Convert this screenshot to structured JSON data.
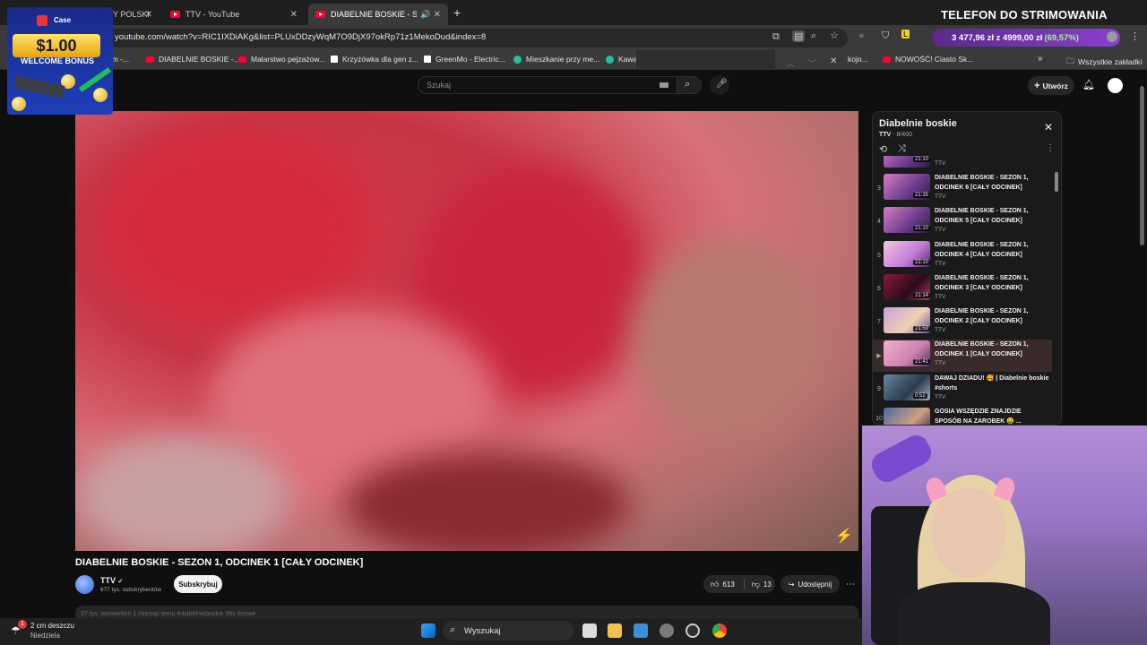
{
  "tabs": [
    {
      "label": "Y POLSKI",
      "active": false
    },
    {
      "label": "TTV - YouTube",
      "active": false
    },
    {
      "label": "DIABELNIE BOSKIE - SEZON",
      "active": true
    }
  ],
  "address": {
    "url": "youtube.com/watch?v=RIC1IXDiAKg&list=PLUxDDzyWqM7O9DjX97okRp71z1MekoDud&index=8"
  },
  "price_extension": {
    "text": "3 477,96 zł z 4999,00 zł",
    "percent": "(69,57%)"
  },
  "bookmarks": [
    {
      "label": "um -...",
      "icon": "youtube-icon"
    },
    {
      "label": "DIABELNIE BOSKIE -...",
      "icon": "youtube-icon"
    },
    {
      "label": "Malarstwo pejzażow...",
      "icon": "youtube-icon"
    },
    {
      "label": "Krzyżówka dla gen z...",
      "icon": "page-icon"
    },
    {
      "label": "GreenMo - Electric...",
      "icon": "page-icon"
    },
    {
      "label": "Mieszkanie przy me...",
      "icon": "chatgpt-icon"
    },
    {
      "label": "Kawal",
      "icon": "chatgpt-icon"
    },
    {
      "label": "kojo...",
      "icon": "page-icon"
    },
    {
      "label": "NOWOŚĆ! Ciasto Sk...",
      "icon": "youtube-icon"
    }
  ],
  "bookmarks_all": "Wszystkie zakładki",
  "youtube": {
    "search_placeholder": "Szukaj",
    "create_label": "Utwórz",
    "video_title": "DIABELNIE BOSKIE - SEZON 1, ODCINEK 1 [CAŁY ODCINEK]",
    "channel": "TTV",
    "subscribers": "677 tys. subskrybentów",
    "subscribe_label": "Subskrybuj",
    "likes": "613",
    "dislikes": "13",
    "share_label": "Udostępnij",
    "description_peek": "37 tys. wyświetleń  1 miesiąc temu  #diabelnieboskie #ttv #nowe"
  },
  "playlist": {
    "title": "Diabelnie boskie",
    "channel": "TTV",
    "position": "8/400",
    "top_partial": {
      "duration": "21:10",
      "channel": "TTV"
    },
    "items": [
      {
        "index": "3",
        "title": "DIABELNIE BOSKIE - SEZON 1, ODCINEK 6 [CAŁY ODCINEK]",
        "channel": "TTV",
        "duration": "21:35",
        "current": false
      },
      {
        "index": "4",
        "title": "DIABELNIE BOSKIE - SEZON 1, ODCINEK 5 [CAŁY ODCINEK]",
        "channel": "TTV",
        "duration": "21:10",
        "current": false
      },
      {
        "index": "5",
        "title": "DIABELNIE BOSKIE - SEZON 1, ODCINEK 4 [CAŁY ODCINEK]",
        "channel": "TTV",
        "duration": "22:10",
        "current": false
      },
      {
        "index": "6",
        "title": "DIABELNIE BOSKIE - SEZON 1, ODCINEK 3 [CAŁY ODCINEK]",
        "channel": "TTV",
        "duration": "21:14",
        "current": false
      },
      {
        "index": "7",
        "title": "DIABELNIE BOSKIE - SEZON 1, ODCINEK 2 [CAŁY ODCINEK]",
        "channel": "TTV",
        "duration": "21:59",
        "current": false
      },
      {
        "index": "▶",
        "title": "DIABELNIE BOSKIE - SEZON 1, ODCINEK 1 [CAŁY ODCINEK]",
        "channel": "TTV",
        "duration": "21:41",
        "current": true
      },
      {
        "index": "9",
        "title": "DAWAJ DZIADU! 🥰 | Diabelnie boskie #shorts",
        "channel": "TTV",
        "duration": "0:52",
        "current": false
      },
      {
        "index": "10",
        "title": "GOSIA WSZĘDZIE ZNAJDZIE SPOSÓB NA ZAROBEK 🤑 ...",
        "channel": "",
        "duration": "",
        "current": false
      }
    ]
  },
  "overlay": {
    "stream_title": "TELEFON DO STRIMOWANIA"
  },
  "ad": {
    "brand": "Case",
    "price": "$1.00",
    "bonus": "WELCOME BONUS"
  },
  "taskbar": {
    "weather": "2 cm deszczu",
    "day": "Niedziela",
    "search": "Wyszukaj",
    "badge": "1"
  }
}
